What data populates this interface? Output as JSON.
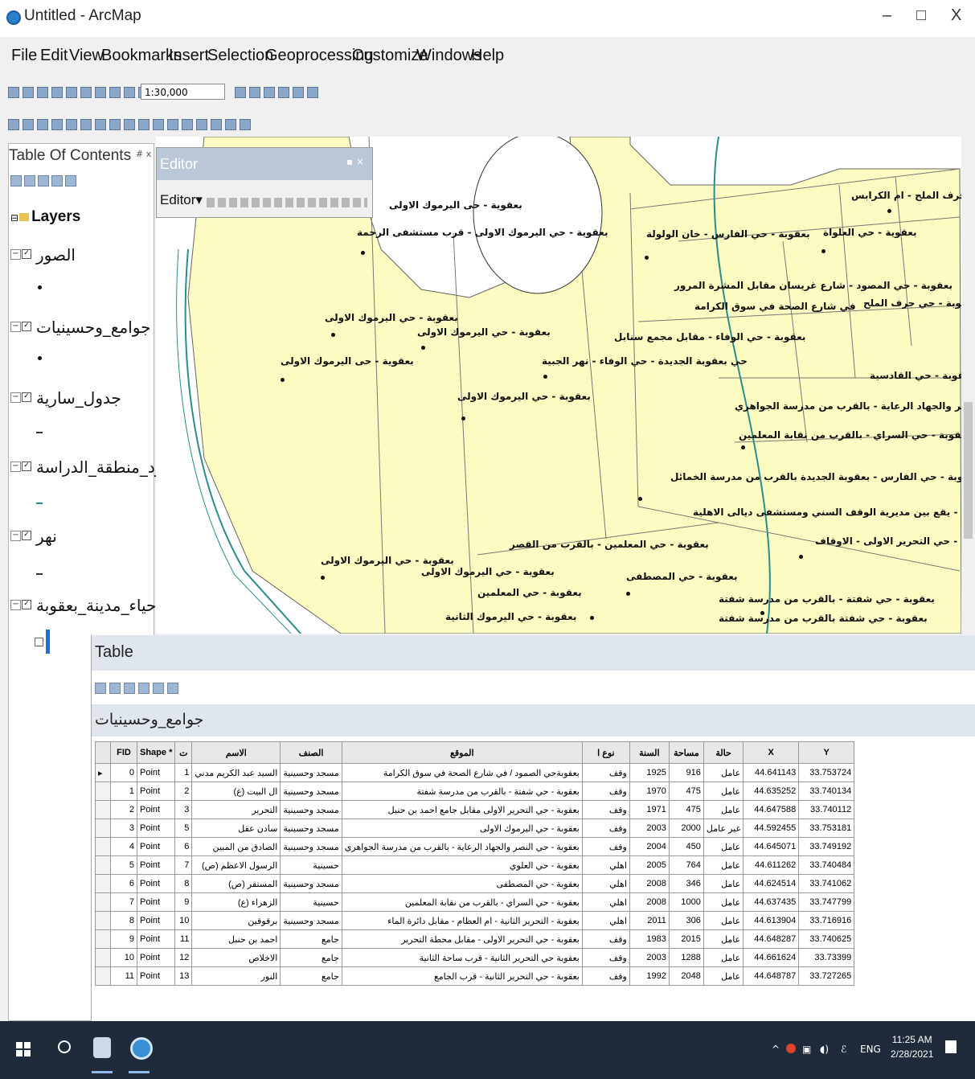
{
  "window": {
    "title": "Untitled - ArcMap",
    "minimize": "–",
    "maximize": "□",
    "close": "X"
  },
  "menu": [
    "File",
    "Edit",
    "View",
    "Bookmarks",
    "Insert",
    "Selection",
    "Geoprocessing",
    "Customize",
    "Windows",
    "Help"
  ],
  "toolbar": {
    "scale": "1:30,000"
  },
  "toc": {
    "title": "Table Of Contents",
    "close": "# x",
    "root": "Layers",
    "layers": [
      {
        "name": "الصور",
        "symbol": "point"
      },
      {
        "name": "جوامع_وحسينيات",
        "symbol": "point"
      },
      {
        "name": "جدول_سارية",
        "symbol": "line"
      },
      {
        "name": "حدود_منطقة_الدراسة",
        "symbol": "line-blue"
      },
      {
        "name": "نهر",
        "symbol": "line"
      },
      {
        "name": "احياء_مدينة_بعقوبة",
        "symbol": "polygon"
      }
    ]
  },
  "editor": {
    "title": "Editor",
    "menu": "Editor▾",
    "close": "▪ ×"
  },
  "map_labels": [
    "بعقوية - جرف الملح - ام الكرابس",
    "بعقوية - حى اليرموك الاولى",
    "بعقوية - حي اليرموك الاولى - قرب مستشفى الرحمة",
    "بعقوبة - حي الفارس - خان الولولة",
    "بعقوية - حي العلواة",
    "بعقوبة - حي المصود - شارع غريسان مقابل المشرة المرور",
    "بعقوبة - حي جرف الملح",
    "بعقوبة - حي اليرموك الاولى",
    "بعقوبة - حي اليرموك الاولى",
    "في شارع الصحة في سوق الكرامة",
    "بعقوبة - حي الوفاء - مقابل مجمع سنابل",
    "حي بعقوبة الجديدة - حي الوفاء - نهر الجبية",
    "بعقوية - حى اليرموك الاولى",
    "بعقوبة - حي القادسية",
    "بعقوبة - حي اليرموك الاولى",
    "بعقوبة - حي النصر والجهاد الرعاية - بالقرب من مدرسة الجواهري",
    "بعقوبة - حي السراي - بالقرب من نقابة المعلمين",
    "بعقوبة - حي الفارس - بعقوبة الجديدة بالقرب من مدرسة الخمائل",
    "بعقوبة - حي التحرير الاولى - يقع بين مديرية الوقف السني ومستشفى ديالى الاهلية",
    "بعقوبة - حي التحرير الاولى - الاوقاف",
    "بعقوبة - حي المعلمين - بالقرب من القصر",
    "بعقوبة - حي اليرموك الاولى",
    "بعقوبة - حي اليرموك الاولى",
    "بعقوبة - حي المصطفى",
    "بعقوبة - حي المعلمين",
    "بعقوبة - حي شفتة - بالقرب من مدرسة شفتة",
    "بعقوبة - حي شفتة بالقرب من مدرسة شفتة",
    "بعقوبة - حي اليرموك الثانية"
  ],
  "table": {
    "window_title": "Table",
    "layer_tab": "جوامع_وحسينيات",
    "columns": [
      "FID",
      "Shape *",
      "ت",
      "الاسم",
      "الصنف",
      "الموقع",
      "نوع ا",
      "السنة",
      "مساحة",
      "حالة",
      "X",
      "Y"
    ],
    "rows": [
      [
        "0",
        "Point",
        "1",
        "السيد عبد الكريم مدني",
        "مسجد وحسينية",
        "بعقوبةحي الصمود / في شارع الصحة في سوق الكرامة",
        "وقف",
        "1925",
        "916",
        "عامل",
        "44.641143",
        "33.753724"
      ],
      [
        "1",
        "Point",
        "2",
        "ال البيت (ع)",
        "مسجد وحسينية",
        "بعقوبة - حي شفتة - بالقرب من مدرسة شفتة",
        "وقف",
        "1970",
        "475",
        "عامل",
        "44.635252",
        "33.740134"
      ],
      [
        "2",
        "Point",
        "3",
        "التحرير",
        "مسجد وحسينية",
        "بعقوبة - حي التحرير الاولى مقابل جامع احمد بن حنبل",
        "وقف",
        "1971",
        "475",
        "عامل",
        "44.647588",
        "33.740112"
      ],
      [
        "3",
        "Point",
        "5",
        "سادن عقل",
        "مسجد وحسينية",
        "بعقوبة - حي اليرموك الاولى",
        "وقف",
        "2003",
        "2000",
        "غير عامل",
        "44.592455",
        "33.753181"
      ],
      [
        "4",
        "Point",
        "6",
        "الصادق من المبين",
        "مسجد وحسينية",
        "بعقوبة - حي النصر والجهاد الرعاية - بالقرب من مدرسة الجواهري",
        "وقف",
        "2004",
        "450",
        "عامل",
        "44.645071",
        "33.749192"
      ],
      [
        "5",
        "Point",
        "7",
        "الرسول الاعظم (ص)",
        "حسينية",
        "بعقوبة - حي العلوي",
        "اهلي",
        "2005",
        "764",
        "عامل",
        "44.611262",
        "33.740484"
      ],
      [
        "6",
        "Point",
        "8",
        "المستقر (ص)",
        "مسجد وحسينية",
        "بعقوبة - حي المصطفى",
        "اهلي",
        "2008",
        "346",
        "عامل",
        "44.624514",
        "33.741062"
      ],
      [
        "7",
        "Point",
        "9",
        "الزهراء (ع)",
        "حسينية",
        "بعقوبة - حي السراي - بالقرب من نقابة المعلمين",
        "اهلي",
        "2008",
        "1000",
        "عامل",
        "44.637435",
        "33.747799"
      ],
      [
        "8",
        "Point",
        "10",
        "برقوقين",
        "مسجد وحسينية",
        "بعقوبة - التحرير الثانية - ام العظام - مقابل دائرة الماء",
        "اهلي",
        "2011",
        "306",
        "عامل",
        "44.613904",
        "33.716916"
      ],
      [
        "9",
        "Point",
        "11",
        "احمد بن حنبل",
        "جامع",
        "بعقوبة - حي التحرير الاولى - مقابل محطة التحرير",
        "وقف",
        "1983",
        "2015",
        "عامل",
        "44.648287",
        "33.740625"
      ],
      [
        "10",
        "Point",
        "12",
        "الاخلاص",
        "جامع",
        "بعقوبة حي التحرير الثانية - قرب ساحة الثانية",
        "وقف",
        "2003",
        "1288",
        "عامل",
        "44.661624",
        "33.73399"
      ],
      [
        "11",
        "Point",
        "13",
        "النور",
        "جامع",
        "بعقوبة - حي التحرير الثانية - قرب الجامع",
        "وقف",
        "1992",
        "2048",
        "عامل",
        "44.648787",
        "33.727265"
      ]
    ]
  },
  "taskbar": {
    "lang": "ENG",
    "time": "11:25 AM",
    "date": "2/28/2021"
  }
}
